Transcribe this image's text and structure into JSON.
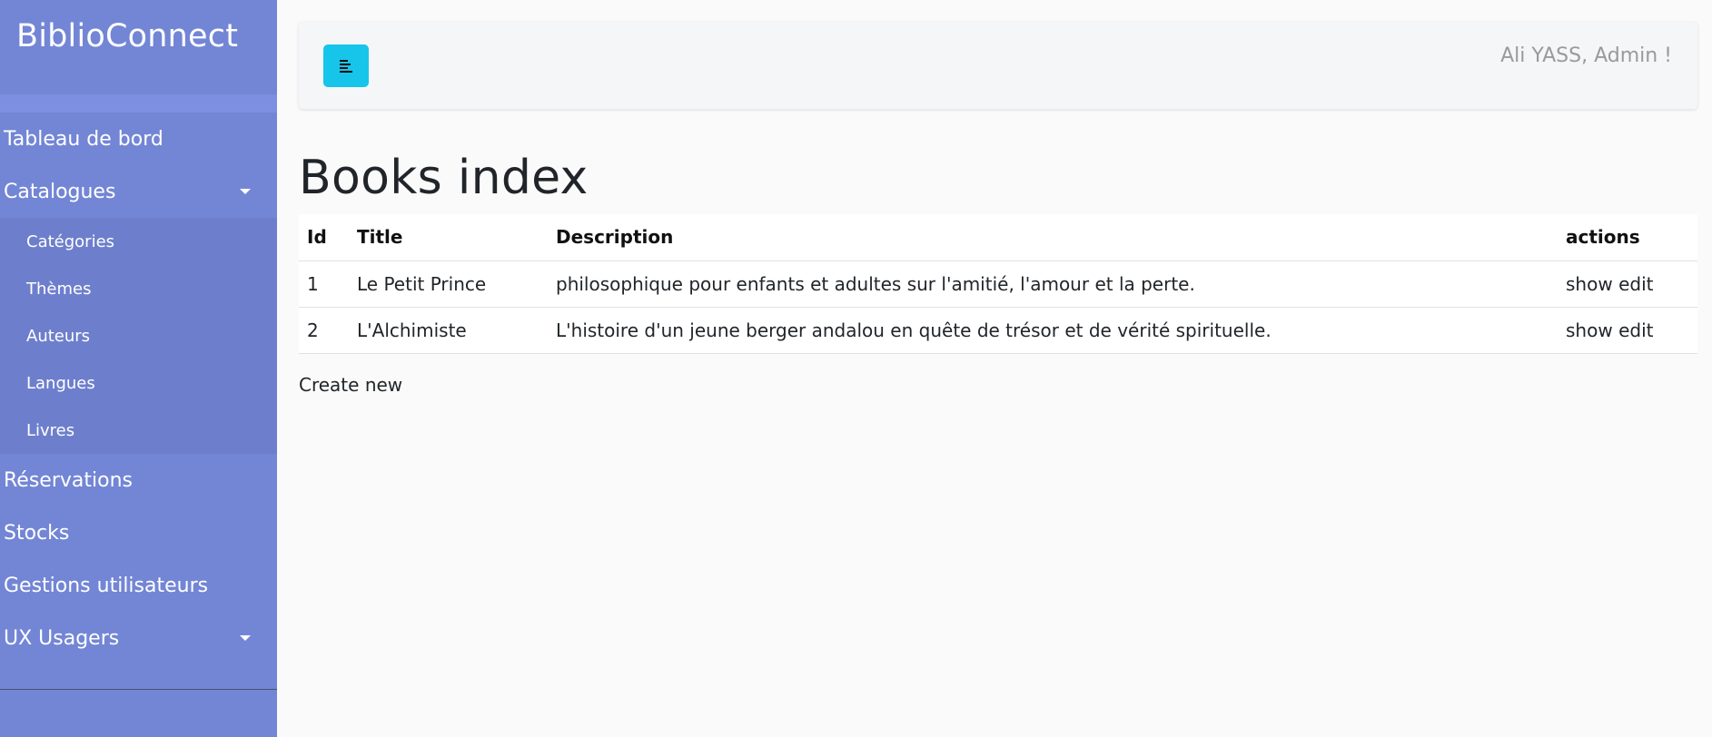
{
  "brand": "BiblioConnect",
  "sidebar": {
    "items": [
      {
        "label": "Tableau de bord"
      },
      {
        "label": "Catalogues",
        "expanded": true,
        "children": [
          "Catégories",
          "Thèmes",
          "Auteurs",
          "Langues",
          "Livres"
        ]
      },
      {
        "label": "Réservations"
      },
      {
        "label": "Stocks"
      },
      {
        "label": "Gestions utilisateurs"
      },
      {
        "label": "UX Usagers"
      }
    ]
  },
  "header": {
    "toggle_icon": "align-left-icon",
    "user_greeting": "Ali YASS, Admin !"
  },
  "main": {
    "title": "Books index",
    "table": {
      "headers": [
        "Id",
        "Title",
        "Description",
        "actions"
      ],
      "rows": [
        {
          "id": "1",
          "title": "Le Petit Prince",
          "description": "philosophique pour enfants et adultes sur l'amitié, l'amour et la perte.",
          "show": "show",
          "edit": "edit"
        },
        {
          "id": "2",
          "title": "L'Alchimiste",
          "description": "L'histoire d'un jeune berger andalou en quête de trésor et de vérité spirituelle.",
          "show": "show",
          "edit": "edit"
        }
      ]
    },
    "create_new": "Create new"
  },
  "colors": {
    "sidebar_bg": "#7386d5",
    "submenu_bg": "#6d7fcc",
    "toggle_bg": "#17c5ea",
    "page_bg": "#fafafa"
  }
}
